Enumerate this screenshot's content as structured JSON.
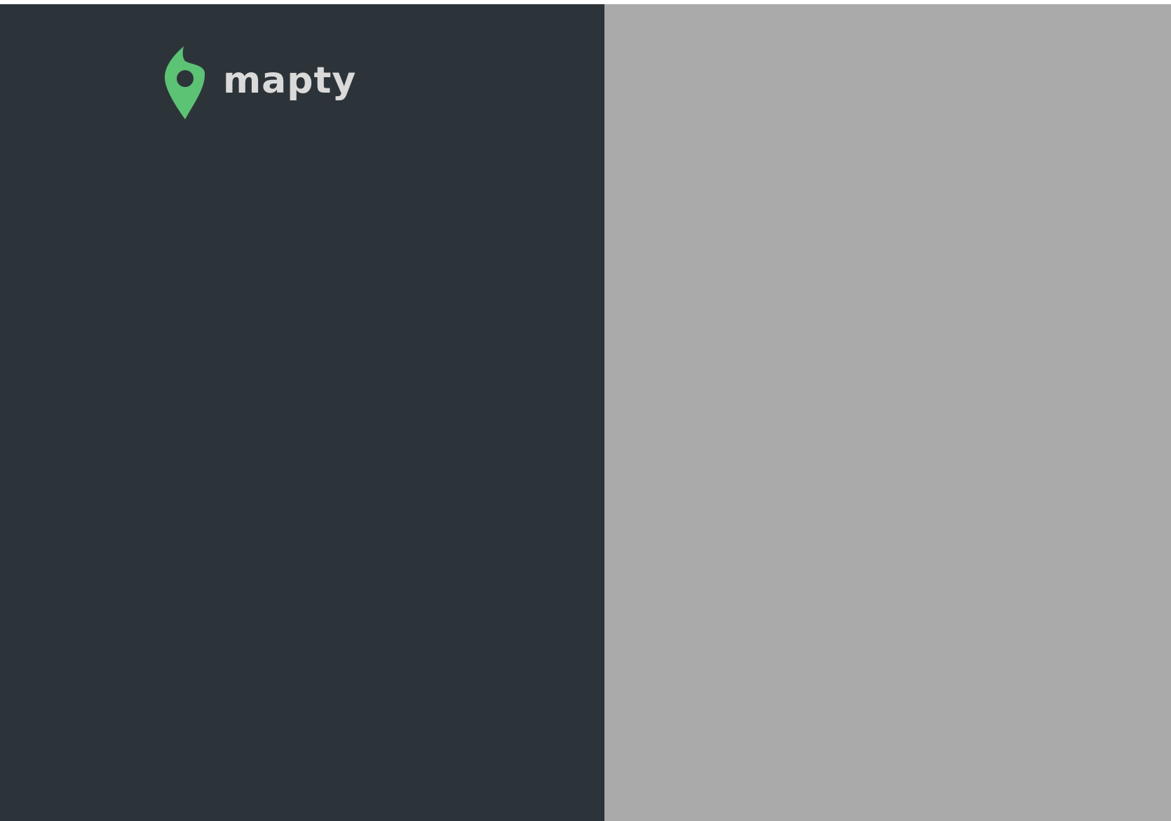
{
  "app": {
    "brand_name": "mapty",
    "logo_icon": "location-pin-icon"
  },
  "colors": {
    "sidebar_background": "#2d3439",
    "map_background": "#aaaaaa",
    "brand_green": "#5cc274",
    "logo_text": "#dadada"
  }
}
